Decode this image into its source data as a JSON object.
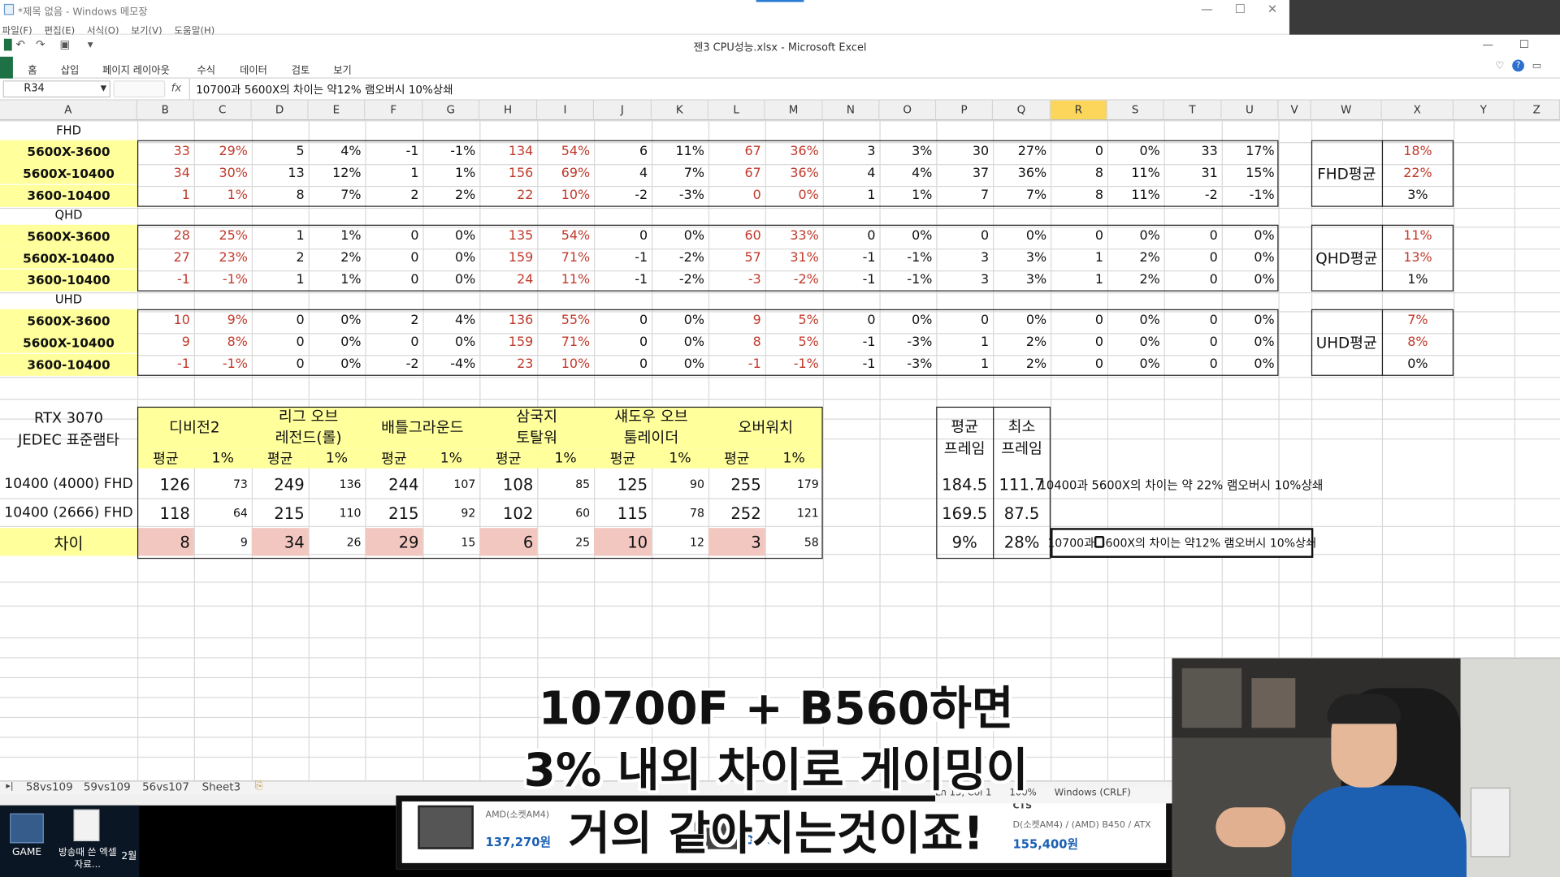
{
  "notepad": {
    "title": "*제목 없음 - Windows 메모장",
    "menu": [
      "파일(F)",
      "편집(E)",
      "서식(O)",
      "보기(V)",
      "도움말(H)"
    ],
    "status": [
      "Ln 15, Col 1",
      "100%",
      "Windows (CRLF)"
    ]
  },
  "excel": {
    "title": "젠3 CPU성능.xlsx - Microsoft Excel",
    "ribbon_tabs": [
      "홈",
      "삽입",
      "페이지 레이아웃",
      "수식",
      "데이터",
      "검토",
      "보기"
    ],
    "name_box": "R34",
    "fx": "fx",
    "formula": "10700과 5600X의 차이는 약12% 램오버시 10%상쇄",
    "columns": [
      "A",
      "B",
      "C",
      "D",
      "E",
      "F",
      "G",
      "H",
      "I",
      "J",
      "K",
      "L",
      "M",
      "N",
      "O",
      "P",
      "Q",
      "R",
      "S",
      "T",
      "U",
      "V",
      "W",
      "X",
      "Y",
      "Z"
    ],
    "selected_column": "R",
    "sheet_tabs": [
      "58vs109",
      "59vs109",
      "56vs107",
      "Sheet3"
    ]
  },
  "sections": [
    {
      "title": "FHD",
      "avg_label": "FHD평균",
      "rows": [
        {
          "label": "5600X-3600",
          "v": [
            "33",
            "29%",
            "5",
            "4%",
            "-1",
            "-1%",
            "134",
            "54%",
            "6",
            "11%",
            "67",
            "36%",
            "3",
            "3%",
            "30",
            "27%",
            "0",
            "0%",
            "33",
            "17%"
          ],
          "avg": "18%"
        },
        {
          "label": "5600X-10400",
          "v": [
            "34",
            "30%",
            "13",
            "12%",
            "1",
            "1%",
            "156",
            "69%",
            "4",
            "7%",
            "67",
            "36%",
            "4",
            "4%",
            "37",
            "36%",
            "8",
            "11%",
            "31",
            "15%"
          ],
          "avg": "22%"
        },
        {
          "label": "3600-10400",
          "v": [
            "1",
            "1%",
            "8",
            "7%",
            "2",
            "2%",
            "22",
            "10%",
            "-2",
            "-3%",
            "0",
            "0%",
            "1",
            "1%",
            "7",
            "7%",
            "8",
            "11%",
            "-2",
            "-1%"
          ],
          "avg": "3%"
        }
      ]
    },
    {
      "title": "QHD",
      "avg_label": "QHD평균",
      "rows": [
        {
          "label": "5600X-3600",
          "v": [
            "28",
            "25%",
            "1",
            "1%",
            "0",
            "0%",
            "135",
            "54%",
            "0",
            "0%",
            "60",
            "33%",
            "0",
            "0%",
            "0",
            "0%",
            "0",
            "0%",
            "0",
            "0%"
          ],
          "avg": "11%"
        },
        {
          "label": "5600X-10400",
          "v": [
            "27",
            "23%",
            "2",
            "2%",
            "0",
            "0%",
            "159",
            "71%",
            "-1",
            "-2%",
            "57",
            "31%",
            "-1",
            "-1%",
            "3",
            "3%",
            "1",
            "2%",
            "0",
            "0%"
          ],
          "avg": "13%"
        },
        {
          "label": "3600-10400",
          "v": [
            "-1",
            "-1%",
            "1",
            "1%",
            "0",
            "0%",
            "24",
            "11%",
            "-1",
            "-2%",
            "-3",
            "-2%",
            "-1",
            "-1%",
            "3",
            "3%",
            "1",
            "2%",
            "0",
            "0%"
          ],
          "avg": "1%"
        }
      ]
    },
    {
      "title": "UHD",
      "avg_label": "UHD평균",
      "rows": [
        {
          "label": "5600X-3600",
          "v": [
            "10",
            "9%",
            "0",
            "0%",
            "2",
            "4%",
            "136",
            "55%",
            "0",
            "0%",
            "9",
            "5%",
            "0",
            "0%",
            "0",
            "0%",
            "0",
            "0%",
            "0",
            "0%"
          ],
          "avg": "7%"
        },
        {
          "label": "5600X-10400",
          "v": [
            "9",
            "8%",
            "0",
            "0%",
            "0",
            "0%",
            "159",
            "71%",
            "0",
            "0%",
            "8",
            "5%",
            "-1",
            "-3%",
            "1",
            "2%",
            "0",
            "0%",
            "0",
            "0%"
          ],
          "avg": "8%"
        },
        {
          "label": "3600-10400",
          "v": [
            "-1",
            "-1%",
            "0",
            "0%",
            "-2",
            "-4%",
            "23",
            "10%",
            "0",
            "0%",
            "-1",
            "-1%",
            "-1",
            "-3%",
            "1",
            "2%",
            "0",
            "0%",
            "0",
            "0%"
          ],
          "avg": "0%"
        }
      ]
    }
  ],
  "bench": {
    "corner": [
      "RTX 3070",
      "JEDEC 표준램타"
    ],
    "games": [
      [
        "디비전2"
      ],
      [
        "리그 오브",
        "레전드(롤)"
      ],
      [
        "배틀그라운드"
      ],
      [
        "삼국지",
        "토탈워"
      ],
      [
        "섀도우 오브",
        "툼레이더"
      ],
      [
        "오버워치"
      ]
    ],
    "sub": [
      "평균",
      "1%"
    ],
    "rows": [
      {
        "label": "10400 (4000) FHD",
        "v": [
          "126",
          "73",
          "249",
          "136",
          "244",
          "107",
          "108",
          "85",
          "125",
          "90",
          "255",
          "179"
        ],
        "avg": "184.5",
        "min": "111.7"
      },
      {
        "label": "10400 (2666) FHD",
        "v": [
          "118",
          "64",
          "215",
          "110",
          "215",
          "92",
          "102",
          "60",
          "115",
          "78",
          "252",
          "121"
        ],
        "avg": "169.5",
        "min": "87.5"
      },
      {
        "label": "차이",
        "v": [
          "8",
          "9",
          "34",
          "26",
          "29",
          "15",
          "6",
          "25",
          "10",
          "12",
          "3",
          "58"
        ],
        "avg": "9%",
        "min": "28%"
      }
    ],
    "avg_head": [
      "평균",
      "프레임"
    ],
    "min_head": [
      "최소",
      "프레임"
    ]
  },
  "notes": [
    "10400과 5600X의 차이는 약 22% 램오버시 10%상쇄",
    "10700과 5600X의 차이는 약12% 램오버시 10%상쇄"
  ],
  "desktop": {
    "icons": [
      {
        "label": "GAME"
      },
      {
        "label": "방송때 쓴 엑셀 자료..."
      },
      {
        "label": "2월"
      }
    ]
  },
  "ad": {
    "items": [
      "AMD(소켓AM4)",
      "137,270원",
      "04,010",
      "CTS",
      "D(소켓AM4) / (AMD) B450 / ATX",
      "155,400원"
    ]
  },
  "subtitles": [
    "10700F + B560하면",
    "3% 내외 차이로 게이밍이",
    "거의 같아지는것이죠!"
  ]
}
